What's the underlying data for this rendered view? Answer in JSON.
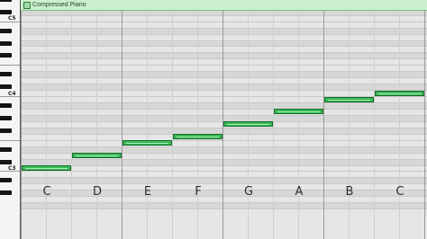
{
  "region": {
    "title": "Compressed Piano"
  },
  "keyboard": {
    "octave_labels": [
      "C5",
      "C4",
      "C3"
    ]
  },
  "notes": [
    {
      "pitch": "C3",
      "label": "C"
    },
    {
      "pitch": "D3",
      "label": "D"
    },
    {
      "pitch": "E3",
      "label": "E"
    },
    {
      "pitch": "F3",
      "label": "F"
    },
    {
      "pitch": "G3",
      "label": "G"
    },
    {
      "pitch": "A3",
      "label": "A"
    },
    {
      "pitch": "B3",
      "label": "B"
    },
    {
      "pitch": "C4",
      "label": "C"
    }
  ],
  "colors": {
    "note_fill": "#39b955",
    "note_border": "#176b2a",
    "region_header": "#cdeecf"
  }
}
